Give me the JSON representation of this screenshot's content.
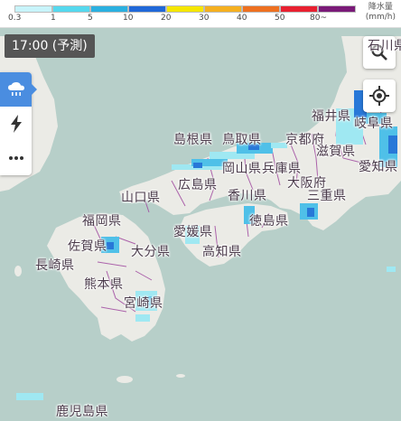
{
  "legend": {
    "segments": [
      {
        "color": "#c8f4fb"
      },
      {
        "color": "#55d8ee"
      },
      {
        "color": "#2bb0e0"
      },
      {
        "color": "#2068d8"
      },
      {
        "color": "#f5e600"
      },
      {
        "color": "#f5b020"
      },
      {
        "color": "#ee7020"
      },
      {
        "color": "#e82030"
      },
      {
        "color": "#7a1a78"
      }
    ],
    "ticks": [
      "0.3",
      "1",
      "5",
      "10",
      "20",
      "30",
      "40",
      "50",
      "80~"
    ],
    "unit_title": "降水量",
    "unit": "(mm/h)"
  },
  "time_label": "17:00 (予測)",
  "side_buttons": [
    {
      "icon": "rain-cloud-icon",
      "active": true
    },
    {
      "icon": "lightning-icon",
      "active": false
    },
    {
      "icon": "more-icon",
      "active": false
    }
  ],
  "controls": {
    "search_icon": "search-icon",
    "location_icon": "locate-icon"
  },
  "prefectures": [
    "石川県",
    "福井県",
    "岐阜県",
    "島根県",
    "鳥取県",
    "京都府",
    "滋賀県",
    "愛知県",
    "岡山県",
    "広島県",
    "兵庫県",
    "山口県",
    "香川県",
    "大阪府",
    "三重県",
    "福岡県",
    "徳島県",
    "愛媛県",
    "佐賀県",
    "大分県",
    "高知県",
    "長崎県",
    "熊本県",
    "宮崎県",
    "鹿児島県"
  ],
  "colors": {
    "sea": "#b7cfc9",
    "land": "#ebebe6",
    "border": "#a04aa0",
    "rain_light": "#9fe8f2",
    "rain_mid": "#4fc0e8",
    "rain_heavy": "#2878d8"
  }
}
